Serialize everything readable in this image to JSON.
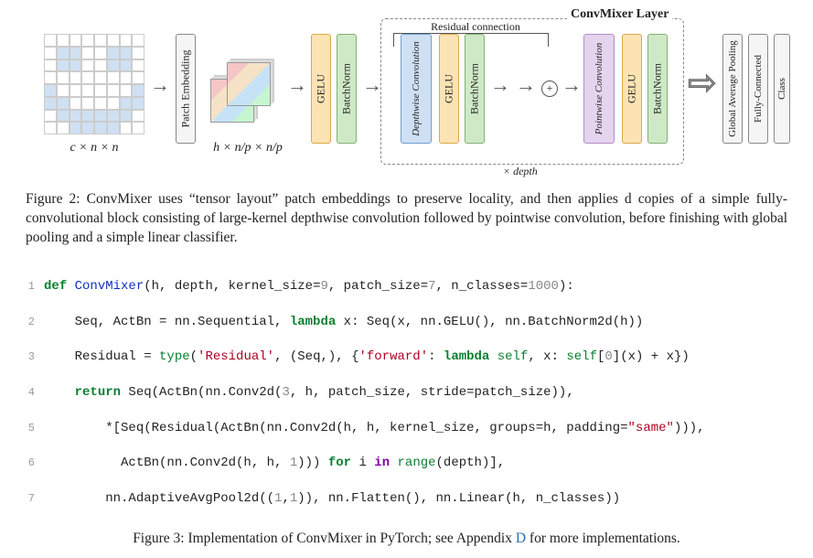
{
  "diagram": {
    "input_label": "c × n × n",
    "patch_label": "Patch Embedding",
    "cube_label": "h × n/p × n/p",
    "gelu": "GELU",
    "bn": "BatchNorm",
    "depthwise": "Depthwise Convolution",
    "pointwise": "Pointwise Convolution",
    "convmixer_title": "ConvMixer Layer",
    "residual": "Residual connection",
    "depth": "× depth",
    "gap": "Global Average Pooling",
    "fc": "Fully-Connected",
    "class": "Class",
    "plus": "+"
  },
  "fig2": {
    "prefix": "Figure 2: ",
    "text": "ConvMixer uses “tensor layout” patch embeddings to preserve locality, and then applies d copies of a simple fully-convolutional block consisting of large-kernel depthwise convolution followed by pointwise convolution, before finishing with global pooling and a simple linear classifier."
  },
  "code": {
    "l1": {
      "def": "def ",
      "name": "ConvMixer",
      "args": "(h, depth, kernel_size=",
      "n9": "9",
      "mid": ", patch_size=",
      "n7": "7",
      "mid2": ", n_classes=",
      "n1000": "1000",
      "end": "):"
    },
    "l2": {
      "a": "    Seq, ActBn = nn.Sequential, ",
      "lam": "lambda",
      "b": " x: Seq(x, nn.GELU(), nn.BatchNorm2d(h))"
    },
    "l3": {
      "a": "    Residual = ",
      "ty": "type",
      "b": "(",
      "s1": "'Residual'",
      "c": ", (Seq,), {",
      "s2": "'forward'",
      "d": ": ",
      "lam": "lambda",
      "e": " ",
      "slf": "self",
      "f": ", x: ",
      "slf2": "self",
      "g": "[",
      "z": "0",
      "h": "](x) + x})"
    },
    "l4": {
      "a": "    ",
      "ret": "return",
      "b": " Seq(ActBn(nn.Conv2d(",
      "n3": "3",
      "c": ", h, patch_size, stride=patch_size)),"
    },
    "l5": {
      "a": "        *[Seq(Residual(ActBn(nn.Conv2d(h, h, kernel_size, groups=h, padding=",
      "s": "\"same\"",
      "b": "))),"
    },
    "l6": {
      "a": "          ActBn(nn.Conv2d(h, h, ",
      "n1": "1",
      "b": "))) ",
      "for": "for",
      "c": " i ",
      "in": "in",
      "d": " ",
      "rng": "range",
      "e": "(depth)],"
    },
    "l7": {
      "a": "        nn.AdaptiveAvgPool2d((",
      "n1": "1",
      "b": ",",
      "n1b": "1",
      "c": ")), nn.Flatten(), nn.Linear(h, n_classes))"
    }
  },
  "fig3": {
    "prefix": "Figure 3: ",
    "text": "Implementation of ConvMixer in PyTorch; see Appendix ",
    "link": "D",
    "tail": " for more implementations."
  }
}
